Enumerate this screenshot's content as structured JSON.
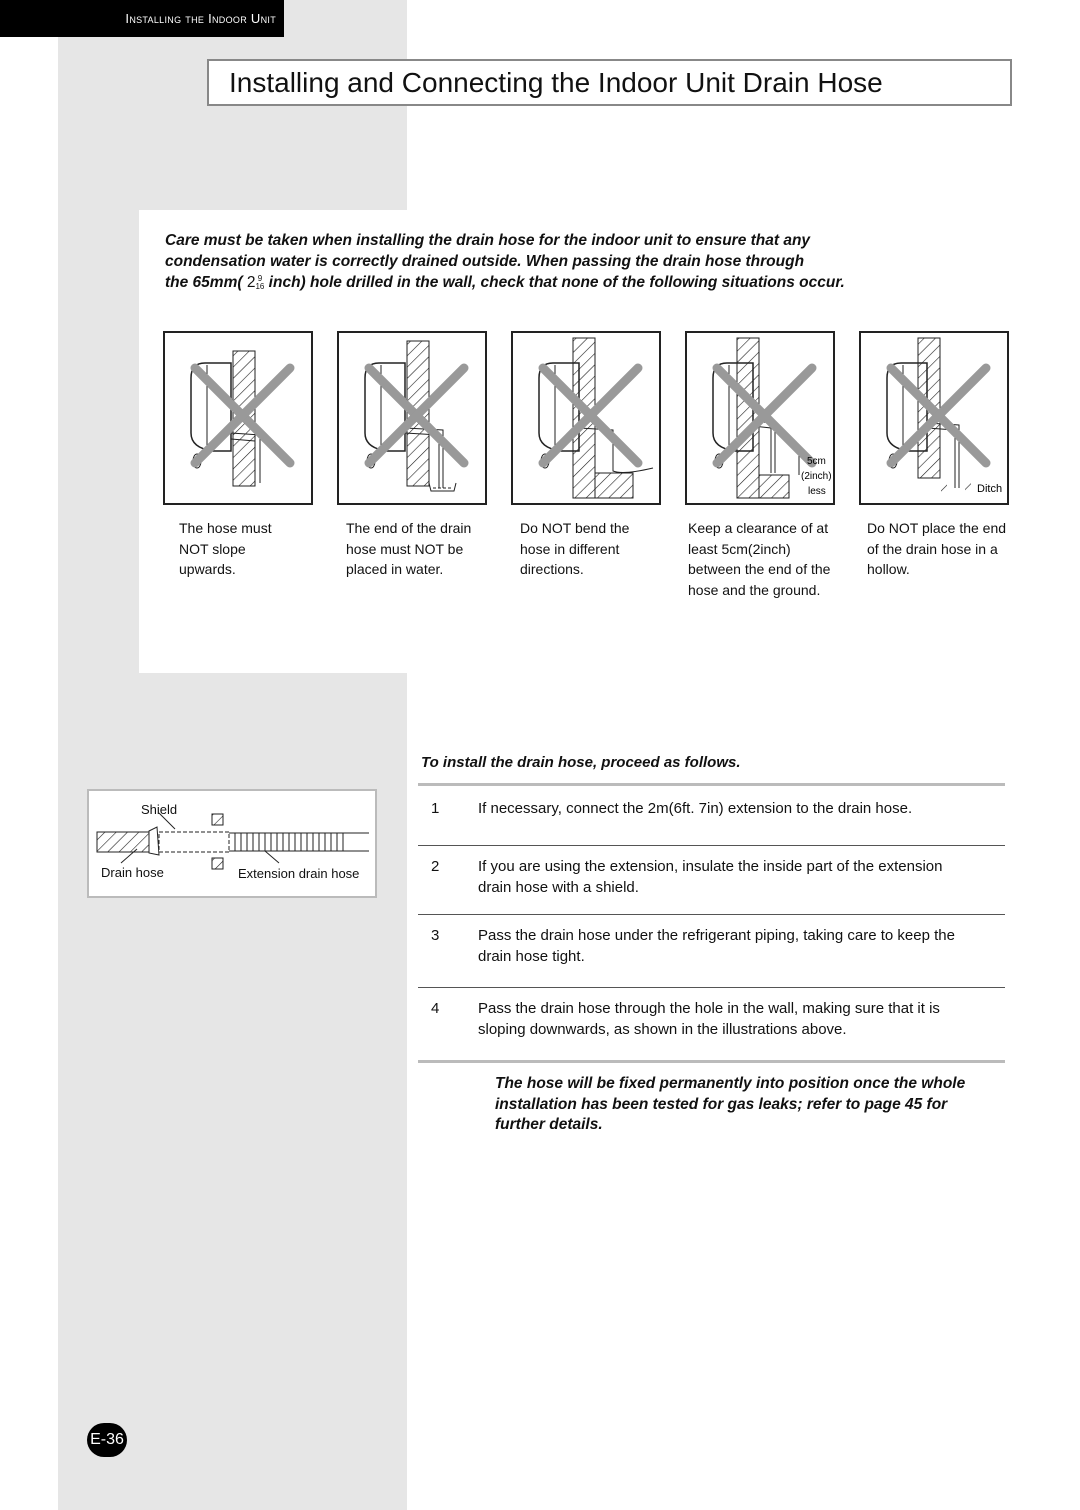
{
  "header": {
    "section": "Installing the Indoor Unit",
    "title": "Installing and Connecting the Indoor Unit Drain Hose"
  },
  "caution": {
    "line1": "Care must be taken when installing the drain hose for the indoor unit to ensure that any",
    "line2": "condensation water is correctly drained outside. When passing the drain hose through",
    "line3_a": "the 65mm(",
    "line3_whole": "2",
    "line3_num": "9",
    "line3_den": "16",
    "line3_b": " inch) hole drilled in the wall, check that none of the following situations occur."
  },
  "illustrations": [
    {
      "caption": "The hose must NOT slope upwards."
    },
    {
      "caption": "The end of the drain hose must NOT be placed in water."
    },
    {
      "caption": "Do NOT bend the hose in different directions."
    },
    {
      "caption": "Keep a clearance of at least 5cm(2inch) between the end of the hose and the ground.",
      "label_5cm": "5cm",
      "label_2inch": "(2inch)",
      "label_less": "less"
    },
    {
      "caption": "Do NOT place the end of the drain hose in a hollow.",
      "label_ditch": "Ditch"
    }
  ],
  "shield_diagram": {
    "shield": "Shield",
    "drain_hose": "Drain hose",
    "extension": "Extension drain hose"
  },
  "procedure": {
    "heading": "To install the drain hose, proceed as follows.",
    "steps": [
      {
        "n": "1",
        "text": "If necessary, connect the 2m(6ft. 7in) extension to the drain hose."
      },
      {
        "n": "2",
        "text": "If you are using the extension, insulate the inside part of the extension drain hose with a shield."
      },
      {
        "n": "3",
        "text": "Pass the drain hose under the refrigerant piping, taking care to keep the drain hose tight."
      },
      {
        "n": "4",
        "text": "Pass the drain hose through the hole in the wall, making sure that it is sloping downwards, as shown in the illustrations above."
      }
    ]
  },
  "note": "The hose will be fixed permanently into position once the whole installation has been tested for gas leaks; refer to page 45 for further details.",
  "page": "E-36"
}
